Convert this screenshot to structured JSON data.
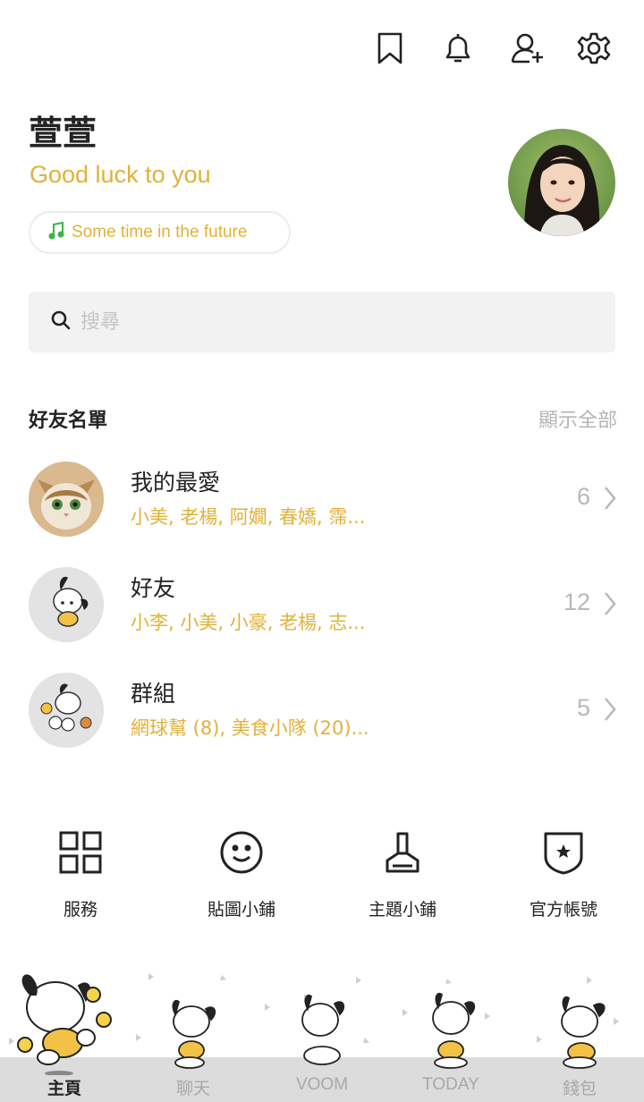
{
  "header": {
    "icons": [
      "bookmark-icon",
      "bell-icon",
      "add-friend-icon",
      "gear-icon"
    ]
  },
  "profile": {
    "name": "萱萱",
    "status": "Good luck to you",
    "music": "Some time in the future"
  },
  "search": {
    "placeholder": "搜尋"
  },
  "friends_section": {
    "title": "好友名單",
    "show_all": "顯示全部",
    "rows": [
      {
        "title": "我的最愛",
        "subtitle": "小美, 老楊, 阿嫺, 春嬌, 霈...",
        "count": "6"
      },
      {
        "title": "好友",
        "subtitle": "小李, 小美, 小豪, 老楊, 志...",
        "count": "12"
      },
      {
        "title": "群組",
        "subtitle": "網球幫 (8), 美食小隊 (20)...",
        "count": "5"
      }
    ]
  },
  "services": [
    {
      "label": "服務",
      "icon": "grid-icon"
    },
    {
      "label": "貼圖小鋪",
      "icon": "smiley-icon"
    },
    {
      "label": "主題小鋪",
      "icon": "brush-icon"
    },
    {
      "label": "官方帳號",
      "icon": "shield-star-icon"
    }
  ],
  "tabs": [
    {
      "label": "主頁",
      "active": true
    },
    {
      "label": "聊天",
      "active": false
    },
    {
      "label": "VOOM",
      "active": false
    },
    {
      "label": "TODAY",
      "active": false
    },
    {
      "label": "錢包",
      "active": false
    }
  ],
  "colors": {
    "accent": "#e0b23a",
    "text": "#222222",
    "muted": "#b5b5b5",
    "search_bg": "#f2f2f2",
    "nav_bg": "#dcdcdc"
  }
}
